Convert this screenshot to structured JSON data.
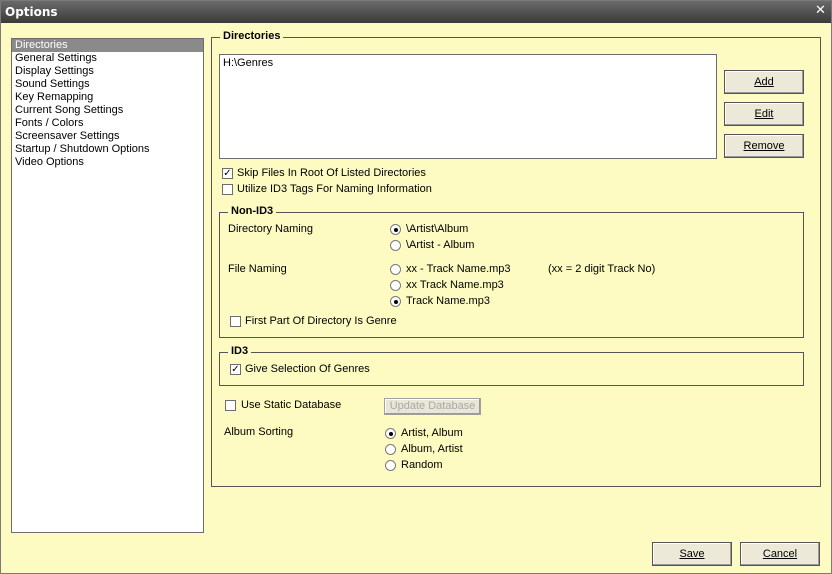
{
  "window": {
    "title": "Options",
    "close_glyph": "✕"
  },
  "sidebar": {
    "items": [
      {
        "label": "Directories",
        "selected": true
      },
      {
        "label": "General Settings",
        "selected": false
      },
      {
        "label": "Display Settings",
        "selected": false
      },
      {
        "label": "Sound Settings",
        "selected": false
      },
      {
        "label": "Key Remapping",
        "selected": false
      },
      {
        "label": "Current Song Settings",
        "selected": false
      },
      {
        "label": "Fonts / Colors",
        "selected": false
      },
      {
        "label": "Screensaver Settings",
        "selected": false
      },
      {
        "label": "Startup / Shutdown Options",
        "selected": false
      },
      {
        "label": "Video Options",
        "selected": false
      }
    ]
  },
  "directories": {
    "legend": "Directories",
    "list_value": "H:\\Genres",
    "add_label": "Add",
    "edit_label": "Edit",
    "remove_label": "Remove",
    "skip_files_label": "Skip Files In Root Of Listed Directories",
    "skip_files_checked": true,
    "utilize_id3_label": "Utilize ID3 Tags For Naming Information",
    "utilize_id3_checked": false
  },
  "non_id3": {
    "legend": "Non-ID3",
    "directory_naming_label": "Directory Naming",
    "dir_option_1": "\\Artist\\Album",
    "dir_option_2": "\\Artist - Album",
    "file_naming_label": "File Naming",
    "file_option_1": "xx - Track Name.mp3",
    "file_option_2": "xx Track Name.mp3",
    "file_option_3": "Track Name.mp3",
    "file_note": "(xx = 2 digit Track No)",
    "first_part_genre_label": "First Part Of Directory Is Genre"
  },
  "id3": {
    "legend": "ID3",
    "give_selection_label": "Give Selection Of Genres"
  },
  "database": {
    "use_static_label": "Use Static Database",
    "update_label": "Update Database",
    "album_sorting_label": "Album Sorting",
    "sort_option_1": "Artist, Album",
    "sort_option_2": "Album, Artist",
    "sort_option_3": "Random"
  },
  "footer": {
    "save_label": "Save",
    "cancel_label": "Cancel"
  },
  "icons": {
    "check": "✓"
  }
}
